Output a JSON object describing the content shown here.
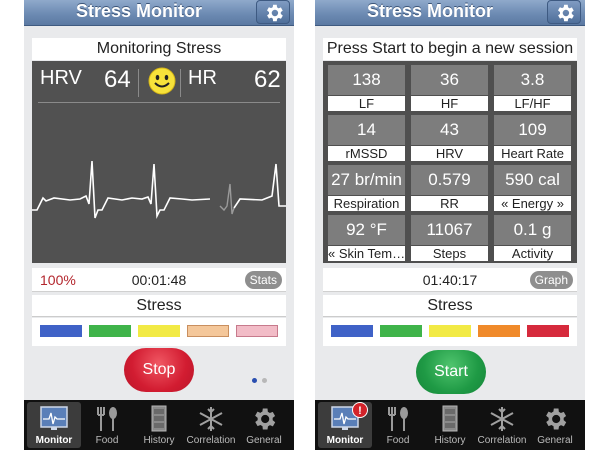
{
  "left_screen": {
    "nav_title": "Stress Monitor",
    "header": "Monitoring Stress",
    "hrv_label": "HRV",
    "hrv_value": "64",
    "hr_label": "HR",
    "hr_value": "62",
    "percent": "100%",
    "timer": "00:01:48",
    "stats_button": "Stats",
    "stress_label": "Stress",
    "stress_colors": [
      "#3f62c7",
      "#3fb44a",
      "#f2ea45",
      "#f4c79a",
      "#f2bcc7"
    ],
    "stop_button": "Stop",
    "tabs": [
      {
        "label": "Monitor",
        "icon": "monitor-icon"
      },
      {
        "label": "Food",
        "icon": "fork-spoon-icon"
      },
      {
        "label": "History",
        "icon": "cabinet-icon"
      },
      {
        "label": "Correlation",
        "icon": "snowflake-icon"
      },
      {
        "label": "General",
        "icon": "gear-icon"
      }
    ]
  },
  "right_screen": {
    "nav_title": "Stress Monitor",
    "header": "Press Start to begin a new session",
    "metrics": [
      {
        "value": "138",
        "label": "LF"
      },
      {
        "value": "36",
        "label": "HF"
      },
      {
        "value": "3.8",
        "label": "LF/HF"
      },
      {
        "value": "14",
        "label": "rMSSD"
      },
      {
        "value": "43",
        "label": "HRV"
      },
      {
        "value": "109",
        "label": "Heart Rate"
      },
      {
        "value": "27 br/min",
        "label": "Respiration"
      },
      {
        "value": "0.579",
        "label": "RR"
      },
      {
        "value": "590 cal",
        "label": "« Energy »"
      },
      {
        "value": "92 °F",
        "label": "« Skin Tem…"
      },
      {
        "value": "11067",
        "label": "Steps"
      },
      {
        "value": "0.1 g",
        "label": "Activity"
      }
    ],
    "timer": "01:40:17",
    "graph_button": "Graph",
    "stress_label": "Stress",
    "stress_colors": [
      "#3f62c7",
      "#3fb44a",
      "#f2ea45",
      "#f08a2a",
      "#d62a3c"
    ],
    "start_button": "Start",
    "badge": "!",
    "tabs": [
      {
        "label": "Monitor",
        "icon": "monitor-icon"
      },
      {
        "label": "Food",
        "icon": "fork-spoon-icon"
      },
      {
        "label": "History",
        "icon": "cabinet-icon"
      },
      {
        "label": "Correlation",
        "icon": "snowflake-icon"
      },
      {
        "label": "General",
        "icon": "gear-icon"
      }
    ]
  },
  "theme": {
    "nav_blue": "#6d8bb3",
    "stop_red": "#d21c31",
    "start_green": "#1f9a45",
    "percent_red": "#b3262d"
  }
}
